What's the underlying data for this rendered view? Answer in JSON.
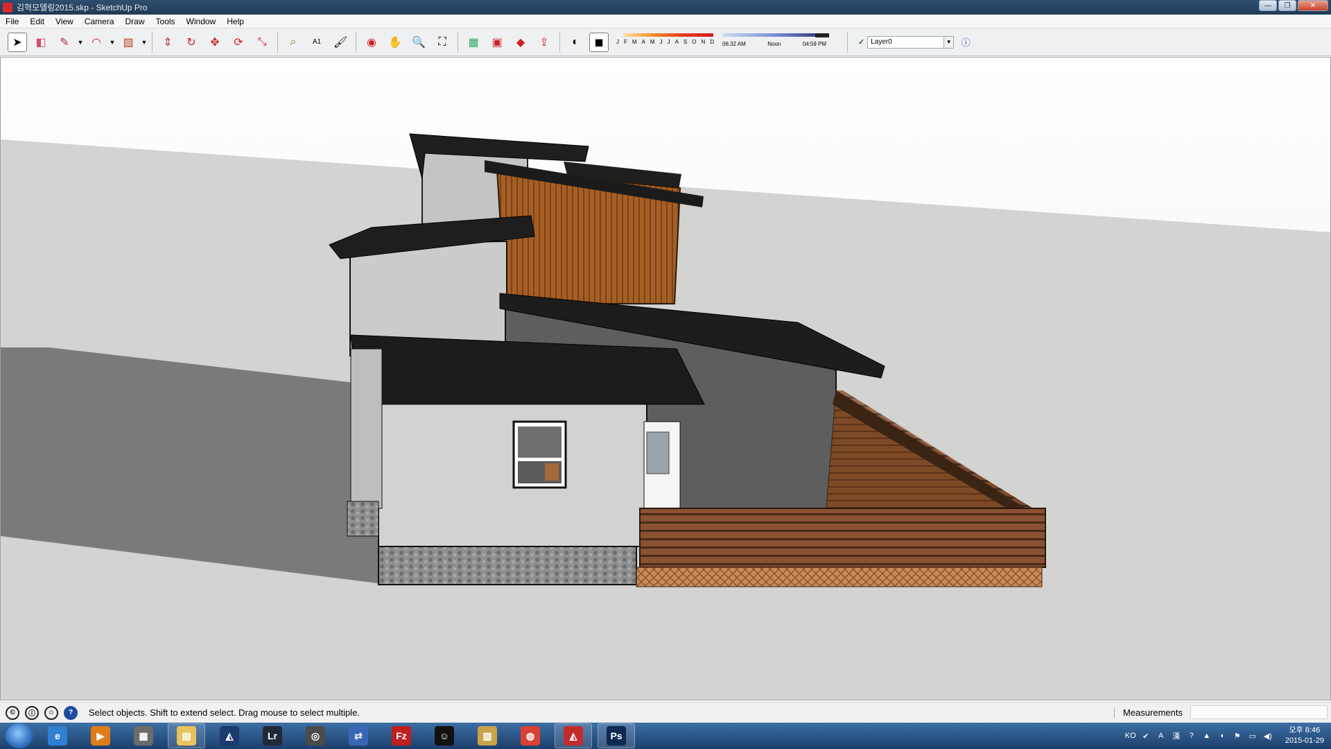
{
  "window": {
    "title": "김혁모델링2015.skp - SketchUp Pro"
  },
  "menu": [
    "File",
    "Edit",
    "View",
    "Camera",
    "Draw",
    "Tools",
    "Window",
    "Help"
  ],
  "toolbar": {
    "tools": [
      {
        "name": "select-tool",
        "glyph": "➤"
      },
      {
        "name": "eraser-tool",
        "glyph": "◧"
      },
      {
        "name": "line-tool",
        "glyph": "✎"
      },
      {
        "name": "arc-tool",
        "glyph": "◠"
      },
      {
        "name": "rectangle-tool",
        "glyph": "▨"
      },
      {
        "name": "push-pull-tool",
        "glyph": "⇕"
      },
      {
        "name": "follow-me-tool",
        "glyph": "↻"
      },
      {
        "name": "move-tool",
        "glyph": "✥"
      },
      {
        "name": "rotate-tool",
        "glyph": "⟳"
      },
      {
        "name": "scale-tool",
        "glyph": "⤡"
      },
      {
        "name": "tape-measure-tool",
        "glyph": "⌕"
      },
      {
        "name": "text-tool",
        "glyph": "A1"
      },
      {
        "name": "paint-bucket-tool",
        "glyph": "🖌"
      },
      {
        "name": "orbit-tool",
        "glyph": "◉"
      },
      {
        "name": "pan-tool",
        "glyph": "✋"
      },
      {
        "name": "zoom-tool",
        "glyph": "🔍"
      },
      {
        "name": "zoom-extents-tool",
        "glyph": "⛶"
      },
      {
        "name": "warehouse-tool",
        "glyph": "▦"
      },
      {
        "name": "extension-tool",
        "glyph": "▣"
      },
      {
        "name": "ruby-tool",
        "glyph": "◆"
      },
      {
        "name": "share-tool",
        "glyph": "⇪"
      },
      {
        "name": "shadows-toggle",
        "glyph": "◐"
      },
      {
        "name": "fog-toggle",
        "glyph": "◼"
      }
    ],
    "months": [
      "J",
      "F",
      "M",
      "A",
      "M",
      "J",
      "J",
      "A",
      "S",
      "O",
      "N",
      "D"
    ],
    "time_start": "06:32 AM",
    "time_mid": "Noon",
    "time_end": "04:59 PM",
    "layer_check": "✓",
    "layer_name": "Layer0"
  },
  "status": {
    "message": "Select objects. Shift to extend select. Drag mouse to select multiple.",
    "measurements_label": "Measurements",
    "measurements_value": ""
  },
  "taskbar": {
    "apps": [
      {
        "name": "ie",
        "label": "e",
        "color": "#2f7fd3"
      },
      {
        "name": "media-player",
        "label": "▶",
        "color": "#e07b1a"
      },
      {
        "name": "photo-app",
        "label": "▦",
        "color": "#6b6b6b"
      },
      {
        "name": "explorer",
        "label": "▤",
        "color": "#e8c25a"
      },
      {
        "name": "sketchup-make",
        "label": "◭",
        "color": "#1b3a6e"
      },
      {
        "name": "lightroom",
        "label": "Lr",
        "color": "#1f2a36"
      },
      {
        "name": "camera-app",
        "label": "◎",
        "color": "#4b4b4b"
      },
      {
        "name": "network-app",
        "label": "⇄",
        "color": "#3a67b5"
      },
      {
        "name": "filezilla",
        "label": "Fz",
        "color": "#bf2020"
      },
      {
        "name": "qq",
        "label": "☺",
        "color": "#111111"
      },
      {
        "name": "archive-app",
        "label": "▥",
        "color": "#c9a24a"
      },
      {
        "name": "chrome",
        "label": "◍",
        "color": "#d94135"
      },
      {
        "name": "sketchup-pro",
        "label": "◭",
        "color": "#c42c2c"
      },
      {
        "name": "photoshop",
        "label": "Ps",
        "color": "#0b2b52"
      }
    ],
    "tray_lang": "KO",
    "clock_time": "오후 8:46",
    "clock_date": "2015-01-29"
  },
  "colors": {
    "roof": "#1e1e1e",
    "wall": "#cfcfcf",
    "wood": "#9c5a24",
    "deck": "#7a4a2a",
    "stone": "#8a8a8a",
    "ground": "#d2d2d0",
    "shadow": "#777777"
  }
}
